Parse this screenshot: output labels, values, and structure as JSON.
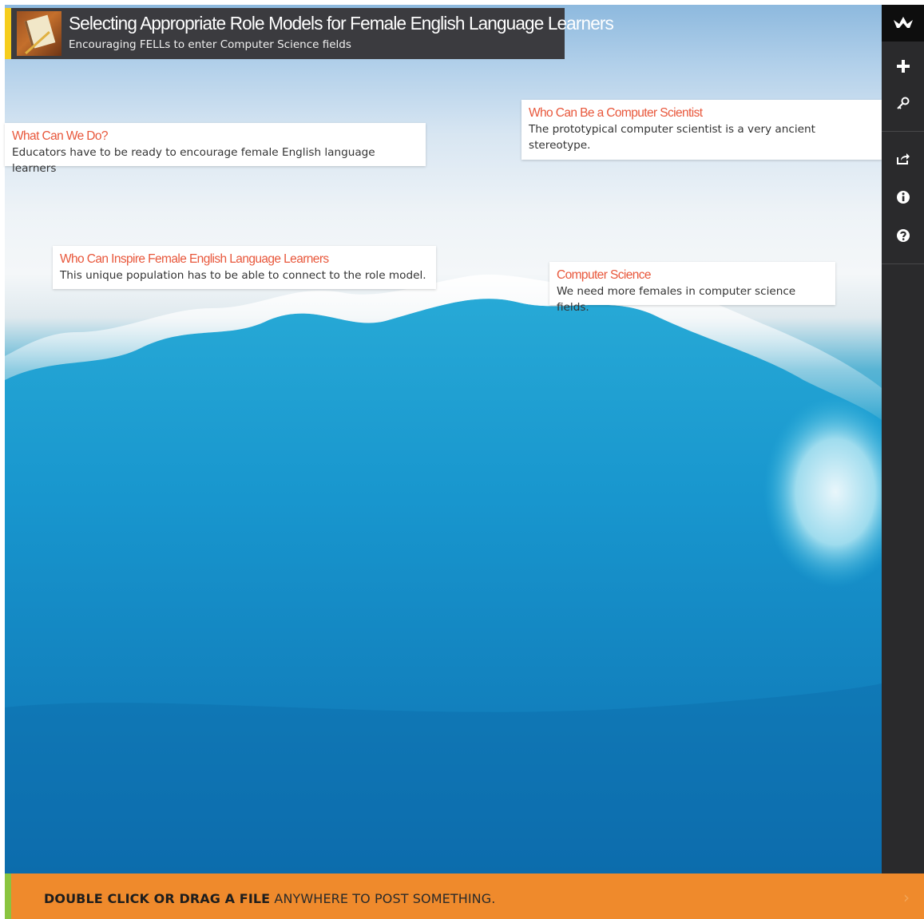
{
  "header": {
    "title": "Selecting Appropriate Role Models for Female English Language Learners",
    "subtitle": "Encouraging FELLs to enter Computer Science fields"
  },
  "posts": [
    {
      "title": "What Can We Do?",
      "body": "Educators have to be ready to encourage female English language learners"
    },
    {
      "title": "Who Can Be a Computer Scientist",
      "body": "The prototypical computer scientist is a very ancient stereotype."
    },
    {
      "title": "Who Can Inspire Female English Language Learners",
      "body": "This unique population has to be able to connect to the role model."
    },
    {
      "title": "Computer Science",
      "body": "We need more females in computer science fields."
    }
  ],
  "sidebar": {
    "icons": [
      "padlet-logo-icon",
      "plus-icon",
      "key-icon",
      "share-icon",
      "info-icon",
      "help-icon"
    ]
  },
  "footer": {
    "bold": "DOUBLE CLICK OR DRAG A FILE",
    "rest": " ANYWHERE TO POST SOMETHING."
  },
  "colors": {
    "header_accent": "#f6cd1c",
    "post_title": "#e8573b",
    "footer": "#ef8a2c",
    "footer_accent": "#8ac43f",
    "sidebar": "#2a2a2c"
  }
}
